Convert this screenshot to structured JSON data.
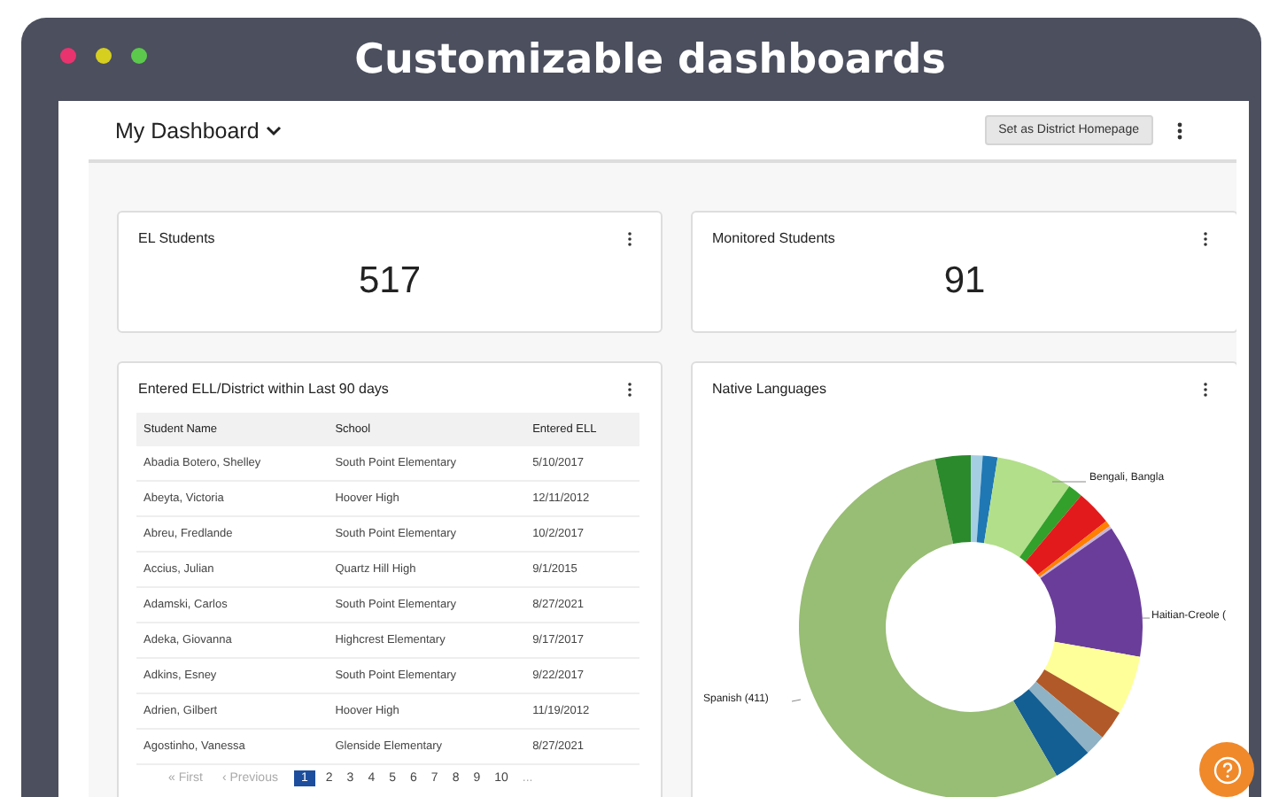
{
  "window": {
    "title": "Customizable dashboards"
  },
  "header": {
    "title": "My Dashboard",
    "button": "Set as District Homepage"
  },
  "stat_cards": [
    {
      "title": "EL Students",
      "value": "517"
    },
    {
      "title": "Monitored Students",
      "value": "91"
    }
  ],
  "table_card": {
    "title": "Entered ELL/District within Last 90 days",
    "columns": [
      "Student Name",
      "School",
      "Entered ELL"
    ],
    "rows": [
      [
        "Abadia Botero, Shelley",
        "South Point Elementary",
        "5/10/2017"
      ],
      [
        "Abeyta, Victoria",
        "Hoover High",
        "12/11/2012"
      ],
      [
        "Abreu, Fredlande",
        "South Point Elementary",
        "10/2/2017"
      ],
      [
        "Accius, Julian",
        "Quartz Hill High",
        "9/1/2015"
      ],
      [
        "Adamski, Carlos",
        "South Point Elementary",
        "8/27/2021"
      ],
      [
        "Adeka, Giovanna",
        "Highcrest Elementary",
        "9/17/2017"
      ],
      [
        "Adkins, Esney",
        "South Point Elementary",
        "9/22/2017"
      ],
      [
        "Adrien, Gilbert",
        "Hoover High",
        "11/19/2012"
      ],
      [
        "Agostinho, Vanessa",
        "Glenside Elementary",
        "8/27/2021"
      ]
    ],
    "pagination": [
      {
        "label": "« First",
        "kind": "nav",
        "selected": false
      },
      {
        "label": "‹ Previous",
        "kind": "nav",
        "selected": false
      },
      {
        "label": "1",
        "kind": "page",
        "selected": true
      },
      {
        "label": "2",
        "kind": "page",
        "selected": false
      },
      {
        "label": "3",
        "kind": "page",
        "selected": false
      },
      {
        "label": "4",
        "kind": "page",
        "selected": false
      },
      {
        "label": "5",
        "kind": "page",
        "selected": false
      },
      {
        "label": "6",
        "kind": "page",
        "selected": false
      },
      {
        "label": "7",
        "kind": "page",
        "selected": false
      },
      {
        "label": "8",
        "kind": "page",
        "selected": false
      },
      {
        "label": "9",
        "kind": "page",
        "selected": false
      },
      {
        "label": "10",
        "kind": "page",
        "selected": false
      },
      {
        "label": "...",
        "kind": "nav",
        "selected": false
      }
    ]
  },
  "chart_card": {
    "title": "Native Languages",
    "labels": [
      "Bengali, Bangla",
      "Haitian-Creole (",
      "Spanish (411)"
    ]
  }
}
